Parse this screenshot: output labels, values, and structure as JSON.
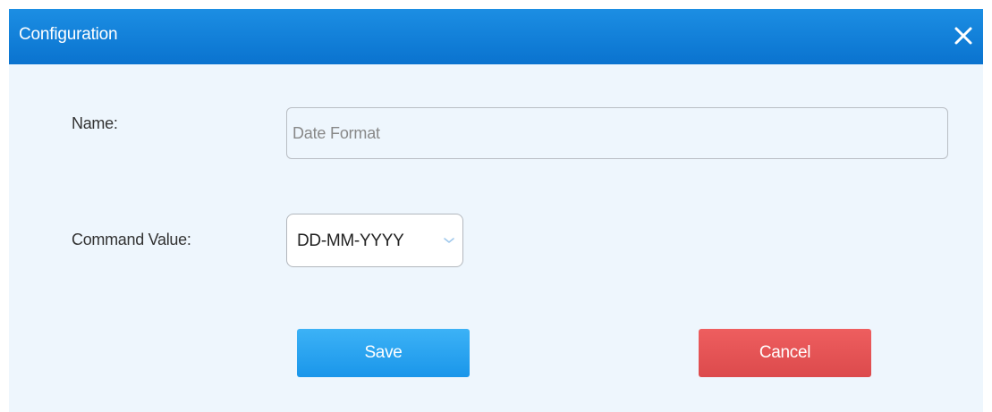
{
  "dialog": {
    "title": "Configuration",
    "close_icon": "close-icon"
  },
  "form": {
    "name_label": "Name:",
    "name_placeholder": "Date Format",
    "name_value": "",
    "command_label": "Command Value:",
    "command_selected": "DD-MM-YYYY",
    "chevron_icon": "chevron-down-icon"
  },
  "actions": {
    "save_label": "Save",
    "cancel_label": "Cancel"
  },
  "colors": {
    "titlebar": "#0f80d9",
    "body": "#eef6fd",
    "save": "#2aa4f0",
    "cancel": "#e55455"
  }
}
